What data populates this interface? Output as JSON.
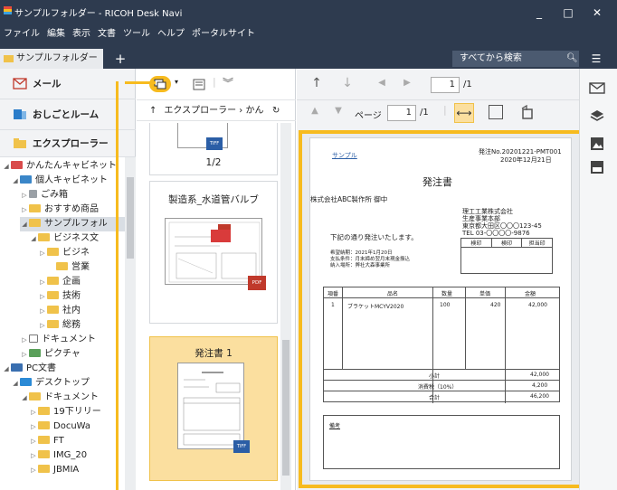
{
  "window": {
    "title": "サンプルフォルダー - RICOH Desk Navi",
    "menu": [
      "ファイル",
      "編集",
      "表示",
      "文書",
      "ツール",
      "ヘルプ",
      "ポータルサイト"
    ],
    "controls": {
      "minimize": "_",
      "maximize": "□",
      "close": "✕"
    }
  },
  "tabs": [
    {
      "label": "サンプルフォルダー"
    }
  ],
  "tab_add": "+",
  "search": {
    "placeholder": "すべてから検索"
  },
  "nav": {
    "mail": "メール",
    "work_room": "おしごとルーム",
    "explorer": "エクスプローラー"
  },
  "tree": [
    {
      "label": "かんたんキャビネット",
      "twisty": "◢",
      "icon": "cabinet"
    },
    {
      "label": "個人キャビネット",
      "twisty": "◢",
      "icon": "cabinet"
    },
    {
      "label": "ごみ箱",
      "twisty": "▷",
      "icon": "trash"
    },
    {
      "label": "おすすめ商品",
      "twisty": "▷",
      "icon": "folder"
    },
    {
      "label": "サンプルフォル",
      "twisty": "◢",
      "icon": "folder"
    },
    {
      "label": "ビジネス文",
      "twisty": "◢",
      "icon": "folder"
    },
    {
      "label": "ビジネ",
      "twisty": "▷",
      "icon": "folder"
    },
    {
      "label": "営業",
      "twisty": "",
      "icon": "folder"
    },
    {
      "label": "企画",
      "twisty": "▷",
      "icon": "folder"
    },
    {
      "label": "技術",
      "twisty": "▷",
      "icon": "folder"
    },
    {
      "label": "社内",
      "twisty": "▷",
      "icon": "folder"
    },
    {
      "label": "総務",
      "twisty": "▷",
      "icon": "folder"
    },
    {
      "label": "ドキュメント",
      "twisty": "▷",
      "icon": "doc"
    },
    {
      "label": "ピクチャ",
      "twisty": "▷",
      "icon": "picture"
    },
    {
      "label": "PC文書",
      "twisty": "◢",
      "icon": "pc"
    },
    {
      "label": "デスクトップ",
      "twisty": "◢",
      "icon": "desktop"
    },
    {
      "label": "ドキュメント",
      "twisty": "◢",
      "icon": "folder"
    },
    {
      "label": "19下リリー",
      "twisty": "▷",
      "icon": "folder"
    },
    {
      "label": "DocuWa",
      "twisty": "▷",
      "icon": "folder"
    },
    {
      "label": "FT",
      "twisty": "▷",
      "icon": "folder"
    },
    {
      "label": "IMG_20",
      "twisty": "▷",
      "icon": "folder"
    },
    {
      "label": "JBMIA",
      "twisty": "▷",
      "icon": "folder"
    }
  ],
  "breadcrumb": {
    "up": "↑",
    "text": "エクスプローラー › かん",
    "refresh": "↻"
  },
  "thumbnails": [
    {
      "label": "1/2",
      "badge": "TIFF"
    },
    {
      "label": "製造系_水道管バルブ",
      "badge": "PDF"
    },
    {
      "label": "発注書 1",
      "badge": "TIFF",
      "selected": true
    }
  ],
  "viewer": {
    "page_field": "1",
    "page_total": "/1",
    "page_label": "ページ",
    "page_field2": "1",
    "page_total2": "/1"
  },
  "document": {
    "sample": "サンプル",
    "order_no": "発注No.20201221-PMT001",
    "date": "2020年12月21日",
    "title": "発注書",
    "to": "株式会社ABC製作所 御中",
    "from_company": "理工工業株式会社",
    "from_dept": "生産事業本部",
    "from_addr": "東京都大田区〇〇〇123-45",
    "from_tel": "TEL 03-〇〇〇〇-9876",
    "intro": "下記の通り発注いたします。",
    "stamp_headers": [
      "検印",
      "検印",
      "担当印"
    ],
    "cond1": "希望納期：2021年1月20日",
    "cond2": "支払条件：月末締め翌月末現金振込",
    "cond3": "納入場所：弊社大森事業所",
    "table_headers": [
      "項番",
      "品名",
      "数量",
      "単価",
      "金額"
    ],
    "rows": [
      {
        "no": "1",
        "name": "ブラケットMCYV2020",
        "qty": "100",
        "price": "420",
        "amount": "42,000"
      }
    ],
    "subtotal_label": "小計",
    "subtotal": "42,000",
    "tax_label": "消費税（10%）",
    "tax": "4,200",
    "total_label": "合計",
    "total": "46,200",
    "notes_label": "備考"
  },
  "colors": {
    "highlight": "#f7bb1f",
    "titlebar": "#2e3b4f",
    "folder": "#f0c24a"
  }
}
